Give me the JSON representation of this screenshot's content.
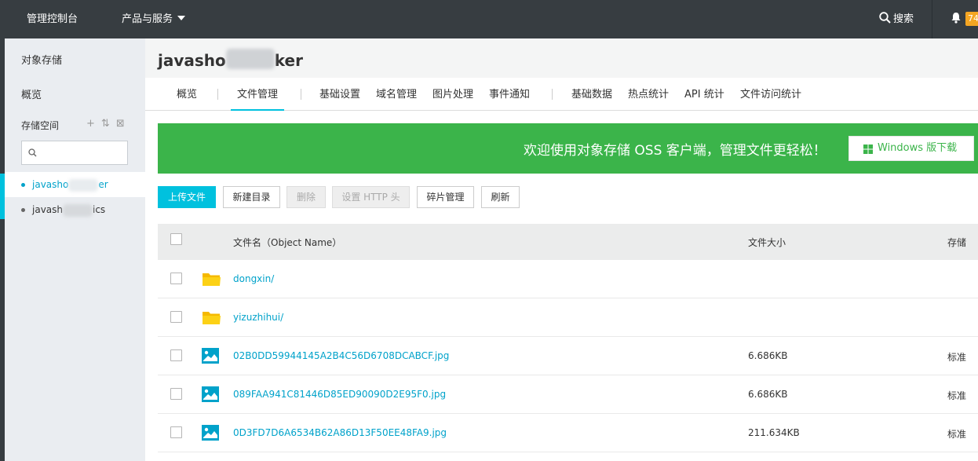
{
  "topbar": {
    "console": "管理控制台",
    "products": "产品与服务",
    "search": "搜索",
    "badge": "74"
  },
  "sidebar": {
    "title": "对象存储",
    "overview": "概览",
    "space": "存储空间",
    "buckets": [
      {
        "prefix": "javasho",
        "suffix": "er"
      },
      {
        "prefix": "javash",
        "suffix": "ics"
      }
    ]
  },
  "header": {
    "bucket_prefix": "javasho",
    "bucket_suffix": "ker"
  },
  "tabs": [
    "概览",
    "文件管理",
    "基础设置",
    "域名管理",
    "图片处理",
    "事件通知",
    "基础数据",
    "热点统计",
    "API 统计",
    "文件访问统计"
  ],
  "banner": {
    "text": "欢迎使用对象存储 OSS 客户端，管理文件更轻松！",
    "download": "Windows 版下载"
  },
  "toolbar": {
    "upload": "上传文件",
    "new_dir": "新建目录",
    "delete": "删除",
    "set_http": "设置 HTTP 头",
    "fragments": "碎片管理",
    "refresh": "刷新"
  },
  "table": {
    "col_name": "文件名（Object Name）",
    "col_size": "文件大小",
    "col_storage": "存储",
    "rows": [
      {
        "name": "dongxin/",
        "type": "folder",
        "size": "",
        "storage": ""
      },
      {
        "name": "yizuzhihui/",
        "type": "folder",
        "size": "",
        "storage": ""
      },
      {
        "name": "02B0DD59944145A2B4C56D6708DCABCF.jpg",
        "type": "image",
        "size": "6.686KB",
        "storage": "标准"
      },
      {
        "name": "089FAA941C81446D85ED90090D2E95F0.jpg",
        "type": "image",
        "size": "6.686KB",
        "storage": "标准"
      },
      {
        "name": "0D3FD7D6A6534B62A86D13F50EE48FA9.jpg",
        "type": "image",
        "size": "211.634KB",
        "storage": "标准"
      }
    ]
  },
  "colors": {
    "accent": "#00c1de",
    "link": "#00a2ca",
    "banner": "#3bb44a",
    "topbar": "#373d41"
  }
}
